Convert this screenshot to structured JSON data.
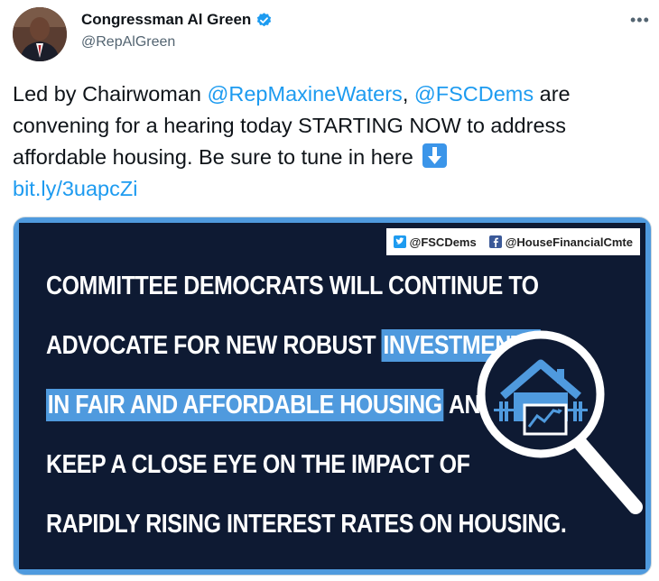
{
  "author": {
    "display_name": "Congressman Al Green",
    "handle": "@RepAlGreen",
    "verified_icon": "verified-badge-icon"
  },
  "more_icon": "more-options-icon",
  "tweet": {
    "p1": "Led by Chairwoman ",
    "mention1": "@RepMaxineWaters",
    "p2": ", ",
    "mention2": "@FSCDems",
    "p3": " are convening for a hearing today STARTING NOW to address affordable housing. Be sure to tune in here ",
    "emoji": "down-arrow-emoji",
    "link": "bit.ly/3uapcZi"
  },
  "card": {
    "twitter_handle": "@FSCDems",
    "facebook_handle": "@HouseFinancialCmte",
    "line1": "COMMITTEE DEMOCRATS WILL CONTINUE TO",
    "line2_a": "ADVOCATE FOR NEW ROBUST ",
    "line2_hl": "INVESTMENTS",
    "line3_hl": "IN FAIR AND AFFORDABLE HOUSING",
    "line3_b": " AND",
    "line4": "KEEP A CLOSE EYE ON THE IMPACT OF",
    "line5": "RAPIDLY RISING INTEREST RATES ON HOUSING.",
    "graphic_icon": "magnifier-house-icon"
  },
  "colors": {
    "link": "#1d9bf0",
    "card_bg": "#0e1a33",
    "highlight": "#4f9ade"
  }
}
